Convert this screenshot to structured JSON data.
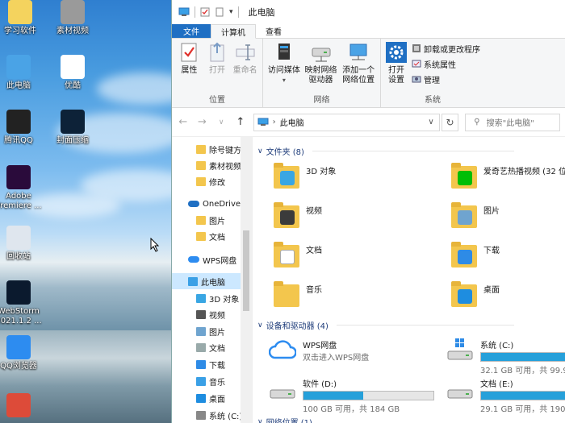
{
  "desktop": {
    "icons": [
      {
        "label": "学习软件",
        "icon": "folder-icon",
        "color": "#f4d35e"
      },
      {
        "label": "素材视频",
        "icon": "recycle-folder-icon",
        "color": "#9a9a9a"
      },
      {
        "label": "此电脑",
        "icon": "computer-icon",
        "color": "#4aa3e6"
      },
      {
        "label": "优酷",
        "icon": "youku-icon",
        "color": "#ffffff"
      },
      {
        "label": "腾讯QQ",
        "icon": "qq-penguin-icon",
        "color": "#222222"
      },
      {
        "label": "封面压缩",
        "icon": "photoshop-icon",
        "color": "#0d2238"
      },
      {
        "label": "Adobe\nPremiere ...",
        "icon": "premiere-icon",
        "color": "#2a0b3b"
      },
      {
        "label": "回收站",
        "icon": "recycle-bin-icon",
        "color": "#dfe6ee"
      },
      {
        "label": "WebStorm\n2021.1.2 ...",
        "icon": "webstorm-icon",
        "color": "#0b1a2e"
      },
      {
        "label": "QQ浏览器",
        "icon": "qq-browser-icon",
        "color": "#2d8cf0"
      },
      {
        "label": "",
        "icon": "chrome-icon",
        "color": "#dd4b39"
      }
    ]
  },
  "window": {
    "title": "此电脑",
    "tabs": {
      "file": "文件",
      "computer": "计算机",
      "view": "查看"
    },
    "ribbon": {
      "location": {
        "name": "位置",
        "properties": "属性",
        "open": "打开",
        "rename": "重命名"
      },
      "network": {
        "name": "网络",
        "media": "访问媒体",
        "map_drive": "映射网络\n驱动器",
        "add_location": "添加一个\n网络位置"
      },
      "system": {
        "name": "系统",
        "settings": "打开\n设置",
        "uninstall": "卸载或更改程序",
        "sys_props": "系统属性",
        "manage": "管理"
      }
    },
    "address": {
      "path": "此电脑",
      "search_placeholder": "搜索\"此电脑\""
    }
  },
  "nav": {
    "items": [
      {
        "label": "除号键方",
        "icon": "folder-icon",
        "indent": 1
      },
      {
        "label": "素材视频",
        "icon": "folder-icon",
        "indent": 1
      },
      {
        "label": "修改",
        "icon": "folder-icon",
        "indent": 1
      },
      {
        "label": "OneDrive",
        "icon": "onedrive-icon",
        "indent": 0
      },
      {
        "label": "图片",
        "icon": "folder-icon",
        "indent": 1
      },
      {
        "label": "文档",
        "icon": "folder-icon",
        "indent": 1
      },
      {
        "label": "WPS网盘",
        "icon": "wps-cloud-icon",
        "indent": 0
      },
      {
        "label": "此电脑",
        "icon": "computer-icon",
        "indent": 0,
        "selected": true
      },
      {
        "label": "3D 对象",
        "icon": "3d-objects-icon",
        "indent": 1
      },
      {
        "label": "视频",
        "icon": "videos-icon",
        "indent": 1
      },
      {
        "label": "图片",
        "icon": "pictures-icon",
        "indent": 1
      },
      {
        "label": "文档",
        "icon": "documents-icon",
        "indent": 1
      },
      {
        "label": "下载",
        "icon": "download-icon",
        "indent": 1
      },
      {
        "label": "音乐",
        "icon": "music-icon",
        "indent": 1
      },
      {
        "label": "桌面",
        "icon": "desktop-icon",
        "indent": 1
      },
      {
        "label": "系统 (C:)",
        "icon": "drive-c-icon",
        "indent": 1
      }
    ]
  },
  "content": {
    "folders_header": "文件夹 (8)",
    "folders": [
      {
        "label": "3D 对象",
        "icon": "3d-objects-folder-icon",
        "overlay": "#39a6e3"
      },
      {
        "label": "爱奇艺热播视频 (32 位)",
        "icon": "iqiyi-folder-icon",
        "overlay": "#00be06"
      },
      {
        "label": "视频",
        "icon": "videos-folder-icon",
        "overlay": "#3b3b3b"
      },
      {
        "label": "图片",
        "icon": "pictures-folder-icon",
        "overlay": "#6fa4cf"
      },
      {
        "label": "文档",
        "icon": "documents-folder-icon",
        "overlay": "#ffffff"
      },
      {
        "label": "下载",
        "icon": "downloads-folder-icon",
        "overlay": "#2e8be6"
      },
      {
        "label": "音乐",
        "icon": "music-folder-icon",
        "overlay": "#f3c64d"
      },
      {
        "label": "桌面",
        "icon": "desktop-folder-icon",
        "overlay": "#1e8de0"
      }
    ],
    "drives_header": "设备和驱动器 (4)",
    "drives": [
      {
        "name": "WPS网盘",
        "sub": "双击进入WPS网盘",
        "icon": "wps-cloud-icon"
      },
      {
        "name": "系统 (C:)",
        "sub": "32.1 GB 可用，共 99.9",
        "used": 0.68,
        "icon": "windows-drive-icon"
      },
      {
        "name": "软件 (D:)",
        "sub": "100 GB 可用，共 184 GB",
        "used": 0.46,
        "icon": "hard-drive-icon"
      },
      {
        "name": "文档 (E:)",
        "sub": "29.1 GB 可用，共 190",
        "used": 0.85,
        "icon": "hard-drive-icon"
      }
    ],
    "network_header": "网络位置 (1)"
  }
}
